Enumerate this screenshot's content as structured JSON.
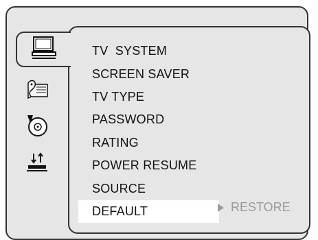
{
  "menu": {
    "items": [
      {
        "label": "TV  SYSTEM"
      },
      {
        "label": "SCREEN SAVER"
      },
      {
        "label": "TV TYPE"
      },
      {
        "label": "PASSWORD"
      },
      {
        "label": "RATING"
      },
      {
        "label": "POWER RESUME"
      },
      {
        "label": "SOURCE"
      },
      {
        "label": "DEFAULT"
      }
    ],
    "selected_index": 7
  },
  "submenu": {
    "value": "RESTORE"
  },
  "icons": [
    {
      "name": "monitor-icon"
    },
    {
      "name": "audio-setup-icon"
    },
    {
      "name": "disc-icon"
    },
    {
      "name": "connection-icon"
    }
  ],
  "colors": {
    "background": "#ffffff",
    "panel": "#e6e6e6",
    "border": "#333333",
    "disabled_text": "#9a9a9a"
  }
}
